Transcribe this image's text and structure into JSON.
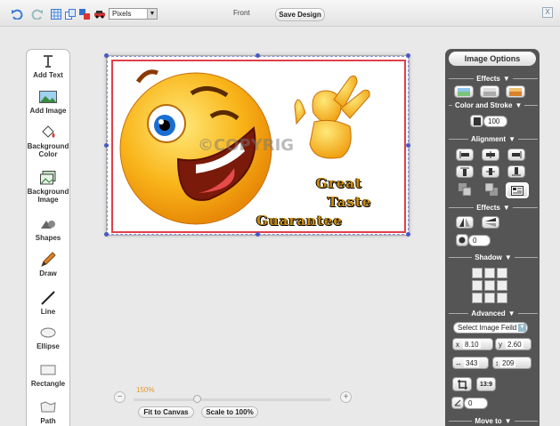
{
  "toolbar": {
    "units_value": "Pixels",
    "side_label": "Front",
    "save_label": "Save Design",
    "close_label": "X"
  },
  "tools": [
    {
      "label": "Add Text",
      "icon": "text-icon"
    },
    {
      "label": "Add Image",
      "icon": "image-icon"
    },
    {
      "label": "Background Color",
      "icon": "paint-bucket-icon"
    },
    {
      "label": "Background Image",
      "icon": "background-image-icon"
    },
    {
      "label": "Shapes",
      "icon": "shapes-icon"
    },
    {
      "label": "Draw",
      "icon": "pencil-icon"
    },
    {
      "label": "Line",
      "icon": "line-icon"
    },
    {
      "label": "Ellipse",
      "icon": "ellipse-icon"
    },
    {
      "label": "Rectangle",
      "icon": "rectangle-icon"
    },
    {
      "label": "Path",
      "icon": "path-icon"
    }
  ],
  "design": {
    "watermark": "©COPYRIG",
    "slogan": [
      "Great",
      "Taste",
      "Guarantee"
    ]
  },
  "zoom": {
    "percent": "150%",
    "fit_label": "Fit to Canvas",
    "scale_label": "Scale to 100%"
  },
  "panel": {
    "title": "Image Options",
    "effects_label": "Effects",
    "color_stroke_label": "Color and Stroke",
    "stroke_value": "100",
    "alignment_label": "Alignment",
    "effects2_label": "Effects",
    "blur_value": "0",
    "shadow_label": "Shadow",
    "advanced_label": "Advanced",
    "select_field": "Select Image Feild",
    "x_label": "x",
    "x_value": "8.10",
    "y_label": "y",
    "y_value": "2.60",
    "width_value": "343",
    "height_value": "209",
    "ratio_label": "13:9",
    "angle_value": "0",
    "move_label": "Move to"
  },
  "colors": {
    "accent_orange": "#e39a2b",
    "panel_bg": "#555555",
    "border_red": "#e0404a",
    "handle_blue": "#4a58c6"
  }
}
